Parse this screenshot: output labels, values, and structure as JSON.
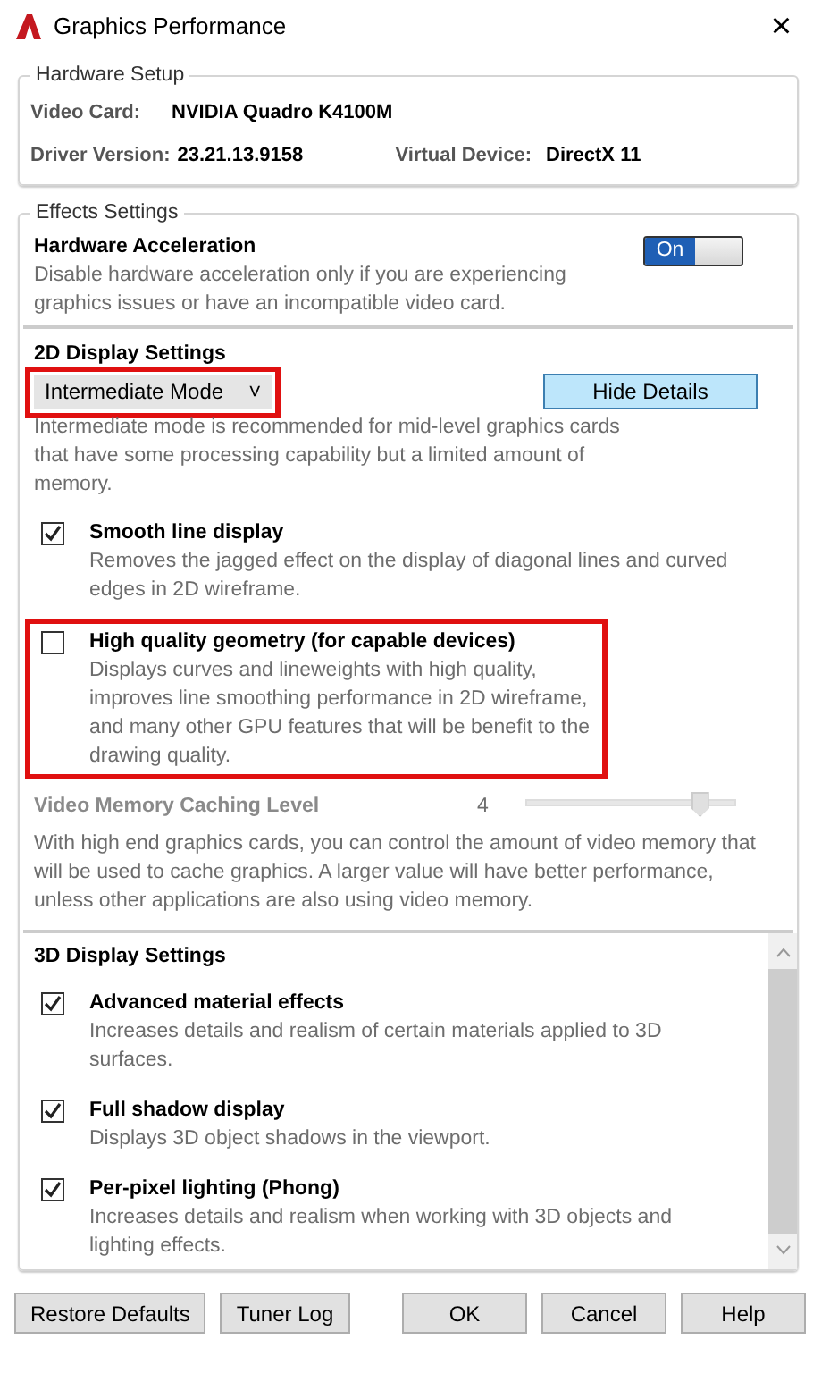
{
  "window": {
    "title": "Graphics Performance",
    "close": "×"
  },
  "hardware_setup": {
    "title": "Hardware Setup",
    "fields": [
      {
        "label": "Video Card:",
        "value": "NVIDIA Quadro K4100M"
      },
      {
        "label": "Driver Version:",
        "value": "23.21.13.9158"
      },
      {
        "label": "Virtual Device:",
        "value": "DirectX 11"
      }
    ]
  },
  "effects": {
    "title": "Effects Settings",
    "hardware_acceleration": {
      "title": "Hardware Acceleration",
      "description": "Disable hardware acceleration only if you are experiencing graphics issues or have an incompatible video card.",
      "toggle": {
        "label": "On",
        "on": true
      }
    },
    "display_2d": {
      "title": "2D Display Settings",
      "mode": {
        "value": "Intermediate Mode",
        "caret": "˅",
        "highlighted": true
      },
      "details_button": "Hide Details",
      "mode_description": "Intermediate mode is recommended for mid-level graphics cards that have some processing capability but a limited amount of memory.",
      "options": [
        {
          "label": "Smooth line display",
          "description": "Removes the jagged effect on the display of diagonal lines and curved edges in 2D wireframe.",
          "checked": true,
          "highlighted": false
        },
        {
          "label": "High quality geometry (for capable devices)",
          "description": "Displays curves and lineweights with high quality, improves line smoothing performance in 2D wireframe, and many other GPU features that will be benefit to the drawing quality.",
          "checked": false,
          "highlighted": true
        }
      ],
      "memory_caching": {
        "label": "Video Memory Caching Level",
        "reading": "4",
        "level": 0.8,
        "disabled": true,
        "description": "With high end graphics cards, you can control the amount of video memory that will be used to cache graphics.  A larger value will have better performance, unless other applications are also using video memory."
      }
    },
    "display_3d": {
      "title": "3D Display Settings",
      "options": [
        {
          "label": "Advanced material effects",
          "description": "Increases details and realism of certain materials applied to 3D surfaces.",
          "checked": true
        },
        {
          "label": "Full shadow display",
          "description": "Displays 3D object shadows in the viewport.",
          "checked": true
        },
        {
          "label": "Per-pixel lighting (Phong)",
          "description": "Increases details and realism when working with 3D objects and lighting effects.",
          "checked": true
        }
      ]
    }
  },
  "left_buttons": [
    "Restore Defaults",
    "Tuner Log"
  ],
  "right_buttons": [
    "OK",
    "Cancel",
    "Help"
  ]
}
